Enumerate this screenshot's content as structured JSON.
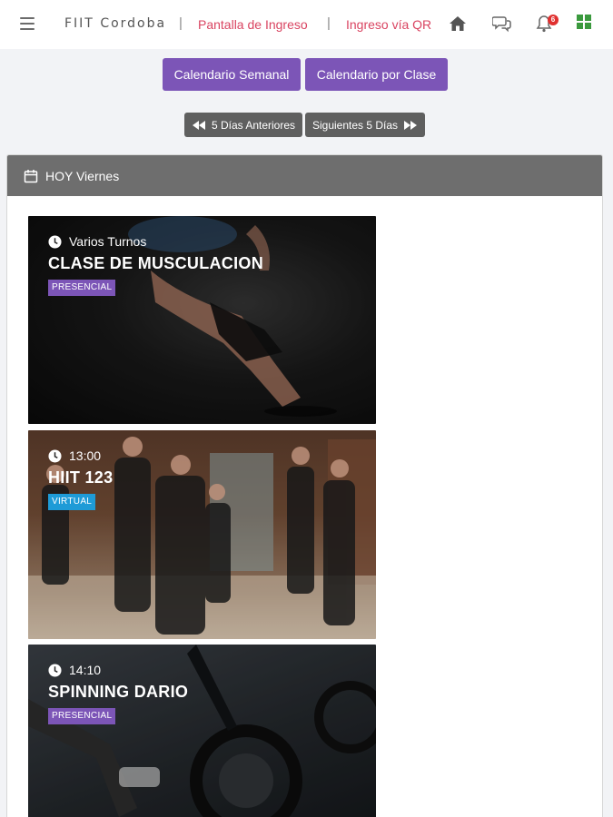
{
  "nav": {
    "brand": "FIIT Cordoba",
    "separator": "|",
    "link_entry": "Pantalla de Ingreso",
    "link_qr": "Ingreso vía QR",
    "notification_count": "6",
    "icons": [
      "menu-icon",
      "home-icon",
      "chat-icon",
      "bell-icon",
      "grid-icon"
    ]
  },
  "calendar_buttons": {
    "weekly": "Calendario Semanal",
    "by_class": "Calendario por Clase"
  },
  "day_nav": {
    "prev": "5 Días Anteriores",
    "next": "Siguientes 5 Días"
  },
  "day": {
    "title": "HOY Viernes"
  },
  "classes": [
    {
      "time": "Varios Turnos",
      "name": "CLASE DE MUSCULACION",
      "mode": "PRESENCIAL"
    },
    {
      "time": "13:00",
      "name": "HIIT 123",
      "mode": "VIRTUAL"
    },
    {
      "time": "14:10",
      "name": "SPINNING DARIO",
      "mode": "PRESENCIAL"
    }
  ],
  "colors": {
    "accent": "#7c55b7",
    "link": "#d94461",
    "virtual": "#1e9bd7",
    "panel_header": "#6e6e6e",
    "badge": "#e0302f"
  }
}
